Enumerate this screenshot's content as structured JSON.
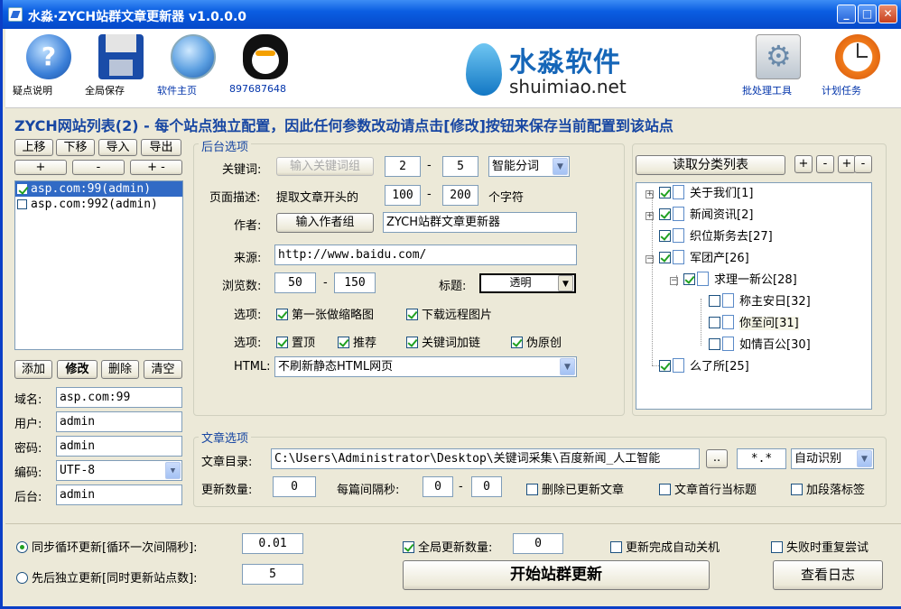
{
  "window": {
    "title": "水淼·ZYCH站群文章更新器 v1.0.0.0"
  },
  "toolbar": {
    "help": "疑点说明",
    "save": "全局保存",
    "home": "软件主页",
    "qq": "897687648",
    "batch": "批处理工具",
    "schedule": "计划任务",
    "icons": [
      "help-icon",
      "save-icon",
      "globe-icon",
      "qq-icon",
      "batch-icon",
      "clock-icon"
    ]
  },
  "logo": {
    "cn": "水淼软件",
    "en": "shuimiao.net"
  },
  "banner": "ZYCH网站列表(2) - 每个站点独立配置，因此任何参数改动请点击[修改]按钮来保存当前配置到该站点",
  "site_panel": {
    "up": "上移",
    "down": "下移",
    "import": "导入",
    "export": "导出",
    "plus": "+",
    "minus": "-",
    "plusminus": "+ -",
    "sites": [
      {
        "label": "asp.com:99(admin)",
        "checked": true
      },
      {
        "label": "asp.com:992(admin)",
        "checked": false
      }
    ],
    "add": "添加",
    "modify": "修改",
    "delete": "删除",
    "clear": "清空",
    "domain_label": "域名:",
    "domain": "asp.com:99",
    "user_label": "用户:",
    "user": "admin",
    "pass_label": "密码:",
    "pass": "admin",
    "enc_label": "编码:",
    "enc": "UTF-8",
    "admin_label": "后台:",
    "admin": "admin"
  },
  "backend": {
    "title": "后台选项",
    "kw_label": "关键词:",
    "kw_button": "输入关键词组",
    "kw_min": "2",
    "dash": "-",
    "kw_max": "5",
    "kw_mode": "智能分词",
    "desc_label": "页面描述:",
    "desc_prefix": "提取文章开头的",
    "desc_min": "100",
    "desc_max": "200",
    "desc_suffix": "个字符",
    "author_label": "作者:",
    "author_button": "输入作者组",
    "author": "ZYCH站群文章更新器",
    "source_label": "来源:",
    "source": "http://www.baidu.com/",
    "views_label": "浏览数:",
    "views_min": "50",
    "views_max": "150",
    "title_label": "标题:",
    "title_value": "透明",
    "opt_label": "选项:",
    "opt1": "第一张做缩略图",
    "opt2": "下载远程图片",
    "opt3": "置顶",
    "opt4": "推荐",
    "opt5": "关键词加链",
    "opt6": "伪原创",
    "html_label": "HTML:",
    "html_value": "不刷新静态HTML网页"
  },
  "category": {
    "read_button": "读取分类列表",
    "b1": "+",
    "b2": "-",
    "b3": "+",
    "b4": "-",
    "nodes": [
      "关于我们[1]",
      "新闻资讯[2]",
      "织位斯务去[27]",
      "军团产[26]",
      "求理一新公[28]",
      "称主安日[32]",
      "你至问[31]",
      "如情百公[30]",
      "么了所[25]"
    ]
  },
  "article": {
    "title": "文章选项",
    "dir_label": "文章目录:",
    "dir": "C:\\Users\\Administrator\\Desktop\\关键词采集\\百度新闻_人工智能",
    "browse": "..",
    "ext": "*.*",
    "encoding": "自动识别",
    "count_label": "更新数量:",
    "count": "0",
    "interval_label": "每篇间隔秒:",
    "int_min": "0",
    "int_max": "0",
    "del": "删除已更新文章",
    "firstline": "文章首行当标题",
    "ptag": "加段落标签"
  },
  "bottom": {
    "sync": "同步循环更新[循环一次间隔秒]:",
    "sync_val": "0.01",
    "seq": "先后独立更新[同时更新站点数]:",
    "seq_val": "5",
    "global": "全局更新数量:",
    "global_val": "0",
    "shutdown": "更新完成自动关机",
    "retry": "失败时重复尝试",
    "start": "开始站群更新",
    "log": "查看日志"
  },
  "colors": {
    "accent": "#1746a2",
    "titlebar": "#0a5de1",
    "check": "#21a121"
  }
}
